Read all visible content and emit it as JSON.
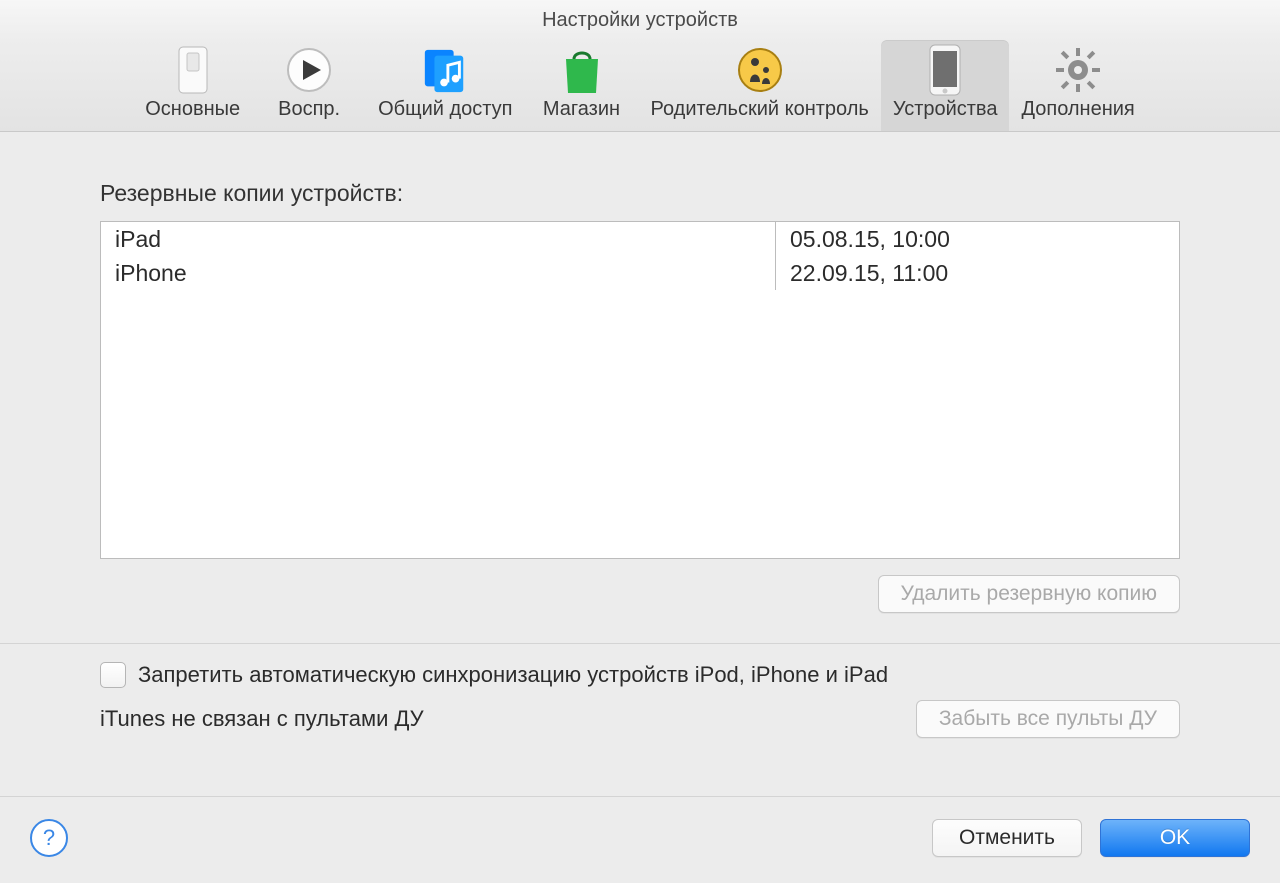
{
  "window": {
    "title": "Настройки устройств"
  },
  "toolbar": {
    "items": [
      {
        "id": "general",
        "label": "Основные"
      },
      {
        "id": "playback",
        "label": "Воспр."
      },
      {
        "id": "sharing",
        "label": "Общий доступ"
      },
      {
        "id": "store",
        "label": "Магазин"
      },
      {
        "id": "parental",
        "label": "Родительский контроль"
      },
      {
        "id": "devices",
        "label": "Устройства",
        "selected": true
      },
      {
        "id": "advanced",
        "label": "Дополнения"
      }
    ]
  },
  "backups": {
    "heading": "Резервные копии устройств:",
    "rows": [
      {
        "device": "iPad",
        "date": "05.08.15, 10:00"
      },
      {
        "device": "iPhone",
        "date": "22.09.15, 11:00"
      }
    ],
    "delete_button": "Удалить резервную копию"
  },
  "options": {
    "prevent_sync_label": "Запретить автоматическую синхронизацию устройств iPod, iPhone и iPad",
    "prevent_sync_checked": false,
    "remotes_status": "iTunes не связан с пультами ДУ",
    "forget_remotes_button": "Забыть все пульты ДУ"
  },
  "footer": {
    "help": "?",
    "cancel": "Отменить",
    "ok": "OK"
  }
}
